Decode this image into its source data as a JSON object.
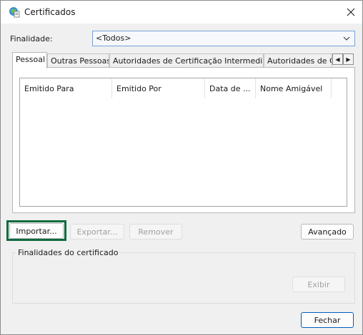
{
  "window": {
    "title": "Certificados",
    "icon": "certificate-icon",
    "close_icon": "close-icon"
  },
  "finalidade": {
    "label": "Finalidade:",
    "selected": "<Todos>"
  },
  "tabs": [
    {
      "label": "Pessoal",
      "active": true
    },
    {
      "label": "Outras Pessoas",
      "active": false
    },
    {
      "label": "Autoridades de Certificação Intermediárias",
      "active": false
    },
    {
      "label": "Autoridades de Ce",
      "active": false
    }
  ],
  "tab_scroll": {
    "left": "◀",
    "right": "▶"
  },
  "list": {
    "columns": [
      "Emitido Para",
      "Emitido Por",
      "Data de ...",
      "Nome Amigável"
    ],
    "rows": []
  },
  "buttons": {
    "importar": "Importar...",
    "exportar": "Exportar...",
    "remover": "Remover",
    "avancado": "Avançado",
    "exibir": "Exibir",
    "fechar": "Fechar"
  },
  "group": {
    "label": "Finalidades do certificado"
  },
  "colors": {
    "focus_ring": "#0d6b3f",
    "select_border": "#7aa1d6",
    "primary_border": "#005fb8"
  }
}
